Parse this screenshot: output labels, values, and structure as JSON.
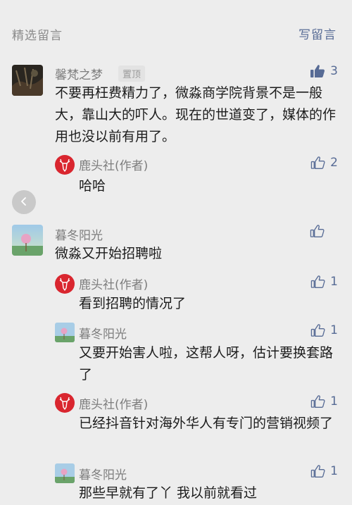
{
  "header": {
    "title": "精选留言",
    "write_label": "写留言"
  },
  "comments": [
    {
      "nick": "馨梵之梦",
      "badge": "置顶",
      "text": "不要再枉费精力了，微淼商学院背景不是一般大，靠山大的吓人。现在的世道变了，媒体的作用也没以前有用了。",
      "likes": "3",
      "liked": true,
      "reply": {
        "nick": "鹿头社(作者)",
        "text": "哈哈",
        "likes": "2"
      }
    },
    {
      "nick": "暮冬阳光",
      "text": "微淼又开始招聘啦",
      "likes": "",
      "replies": [
        {
          "nick": "鹿头社(作者)",
          "text": "看到招聘的情况了",
          "likes": "1"
        },
        {
          "nick": "暮冬阳光",
          "text": "又要开始害人啦，这帮人呀，估计要换套路了",
          "likes": "1"
        },
        {
          "nick": "鹿头社(作者)",
          "text": "已经抖音针对海外华人有专门的营销视频了",
          "likes": "1"
        },
        {
          "nick": "暮冬阳光",
          "text": "那些早就有了丫 我以前就看过",
          "likes": "1"
        }
      ]
    }
  ],
  "icons": {
    "like": "thumbs-up-icon",
    "liked": "thumbs-up-filled-icon",
    "back": "chevron-left-icon",
    "author_avatar": "deer-logo-icon"
  },
  "colors": {
    "link": "#576b95",
    "author_red": "#d9262f"
  }
}
